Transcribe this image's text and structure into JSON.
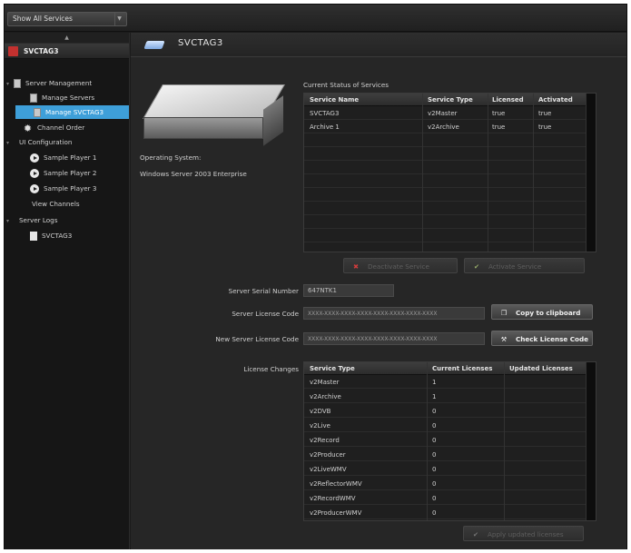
{
  "topbar": {
    "services_select": "Show All Services"
  },
  "sidebar": {
    "collapse_glyph": "▲",
    "header": "SVCTAG3",
    "items": [
      {
        "label": "Server Management",
        "icon": "server-icon",
        "expand": "▾"
      },
      {
        "label": "Manage Servers",
        "icon": "server-icon"
      },
      {
        "label": "Manage SVCTAG3",
        "icon": "server-icon",
        "selected": true
      },
      {
        "label": "Channel Order",
        "icon": "gear-icon"
      },
      {
        "label": "UI Configuration",
        "icon": "none",
        "expand": "▾"
      },
      {
        "label": "Sample Player 1",
        "icon": "play-icon"
      },
      {
        "label": "Sample Player 2",
        "icon": "play-icon"
      },
      {
        "label": "Sample Player 3",
        "icon": "play-icon"
      },
      {
        "label": "View Channels",
        "icon": "none"
      },
      {
        "label": "Server Logs",
        "icon": "none",
        "expand": "▾"
      },
      {
        "label": "SVCTAG3",
        "icon": "document-icon"
      }
    ]
  },
  "main": {
    "title": "SVCTAG3",
    "os_label": "Operating System:",
    "os_value": "Windows Server 2003 Enterprise",
    "status_caption": "Current Status of Services",
    "status_table": {
      "headers": [
        "Service Name",
        "Service Type",
        "Licensed",
        "Activated"
      ],
      "rows": [
        [
          "SVCTAG3",
          "v2Master",
          "true",
          "true"
        ],
        [
          "Archive 1",
          "v2Archive",
          "true",
          "true"
        ]
      ]
    },
    "deactivate_label": "Deactivate Service",
    "activate_label": "Activate Service",
    "serial_label": "Server Serial Number",
    "serial_value": "647NTK1",
    "license_label": "Server License Code",
    "license_value": "XXXX-XXXX-XXXX-XXXX-XXXX-XXXX-XXXX-XXXX",
    "copy_label": "Copy to clipboard",
    "new_license_label": "New Server License Code",
    "new_license_value": "XXXX-XXXX-XXXX-XXXX-XXXX-XXXX-XXXX-XXXX",
    "check_label": "Check License Code",
    "changes_label": "License Changes",
    "license_table": {
      "headers": [
        "Service Type",
        "Current Licenses",
        "Updated Licenses"
      ],
      "rows": [
        [
          "v2Master",
          "1",
          ""
        ],
        [
          "v2Archive",
          "1",
          ""
        ],
        [
          "v2DVB",
          "0",
          ""
        ],
        [
          "v2Live",
          "0",
          ""
        ],
        [
          "v2Record",
          "0",
          ""
        ],
        [
          "v2Producer",
          "0",
          ""
        ],
        [
          "v2LiveWMV",
          "0",
          ""
        ],
        [
          "v2ReflectorWMV",
          "0",
          ""
        ],
        [
          "v2RecordWMV",
          "0",
          ""
        ],
        [
          "v2ProducerWMV",
          "0",
          ""
        ]
      ]
    },
    "apply_label": "Apply updated licenses"
  }
}
